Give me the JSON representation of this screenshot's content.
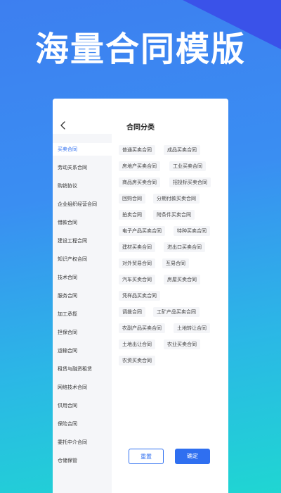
{
  "banner": {
    "title": "海量合同模版"
  },
  "nav": {
    "title": "合同分类"
  },
  "sidebar": {
    "items": [
      "买卖合同",
      "劳动关系合同",
      "购销协议",
      "企业组织经营合同",
      "借款合同",
      "建设工程合同",
      "知识产权合同",
      "技术合同",
      "服务合同",
      "加工承揽",
      "担保合同",
      "运输合同",
      "租赁与融资租赁",
      "网络技术合同",
      "供用合同",
      "保险合同",
      "委托中介合同",
      "仓储保管"
    ],
    "active_index": 0
  },
  "tags": [
    [
      "普通买卖合同",
      "成品买卖合同"
    ],
    [
      "房地产买卖合同",
      "工业买卖合同"
    ],
    [
      "商品房买卖合同",
      "招投标买卖合同"
    ],
    [
      "回购合同",
      "分期付款买卖合同"
    ],
    [
      "拍卖合同",
      "附条件买卖合同"
    ],
    [
      "电子产品买卖合同",
      "特种买卖合同"
    ],
    [
      "建材买卖合同",
      "进出口买卖合同"
    ],
    [
      "对外贸易合同",
      "互易合同"
    ],
    [
      "汽车买卖合同",
      "房屋买卖合同"
    ],
    [
      "凭样品买卖合同"
    ],
    [
      "调拨合同",
      "工矿产品买卖合同"
    ],
    [
      "农副产品买卖合同",
      "土地转让合同"
    ],
    [
      "土地出让合同",
      "农业买卖合同"
    ],
    [
      "农资买卖合同"
    ]
  ],
  "buttons": {
    "reset": "重置",
    "confirm": "确定"
  },
  "colors": {
    "accent": "#2f6ff0"
  }
}
